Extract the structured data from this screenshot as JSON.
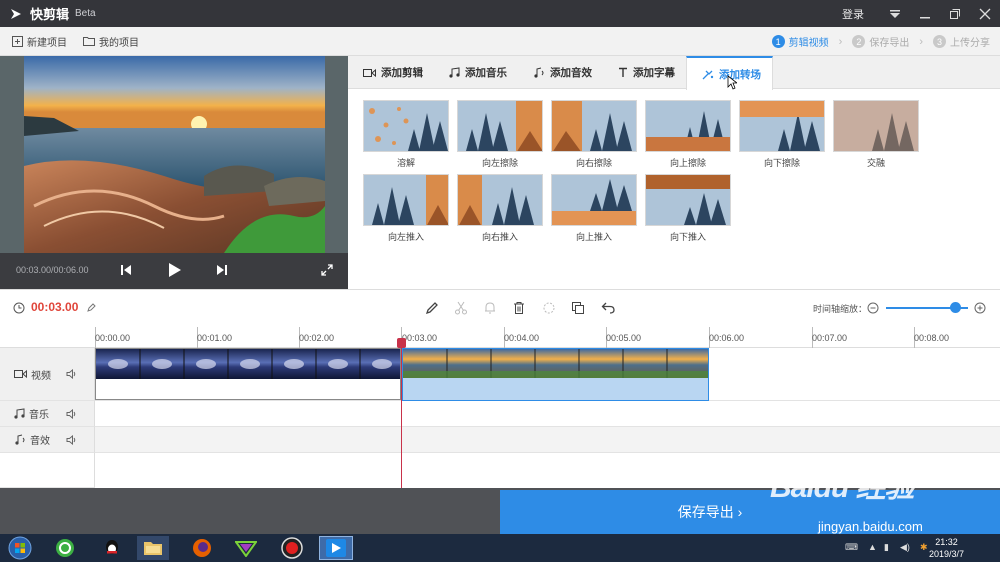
{
  "titlebar": {
    "app_name": "快剪辑",
    "beta": "Beta",
    "login": "登录"
  },
  "toolbar": {
    "new_project": "新建项目",
    "my_projects": "我的项目"
  },
  "steps": [
    {
      "num": "1",
      "label": "剪辑视频"
    },
    {
      "num": "2",
      "label": "保存导出"
    },
    {
      "num": "3",
      "label": "上传分享"
    }
  ],
  "player": {
    "time": "00:03.00/00:06.00"
  },
  "tabs": [
    "添加剪辑",
    "添加音乐",
    "添加音效",
    "添加字幕",
    "添加转场"
  ],
  "transitions": [
    "溶解",
    "向左擦除",
    "向右擦除",
    "向上擦除",
    "向下擦除",
    "交融",
    "向左推入",
    "向右推入",
    "向上推入",
    "向下推入"
  ],
  "timeline": {
    "current_time": "00:03.00",
    "zoom_label": "时间轴缩放：",
    "ticks": [
      "00:00.00",
      "00:01.00",
      "00:02.00",
      "00:03.00",
      "00:04.00",
      "00:05.00",
      "00:06.00",
      "00:07.00",
      "00:08.00"
    ],
    "tracks": {
      "video": "视频",
      "music": "音乐",
      "sfx": "音效"
    }
  },
  "save_button": "保存导出 ›",
  "taskbar": {
    "time": "21:32",
    "date": "2019/3/7"
  },
  "watermark": {
    "logo": "Baidu 经验",
    "url": "jingyan.baidu.com"
  }
}
